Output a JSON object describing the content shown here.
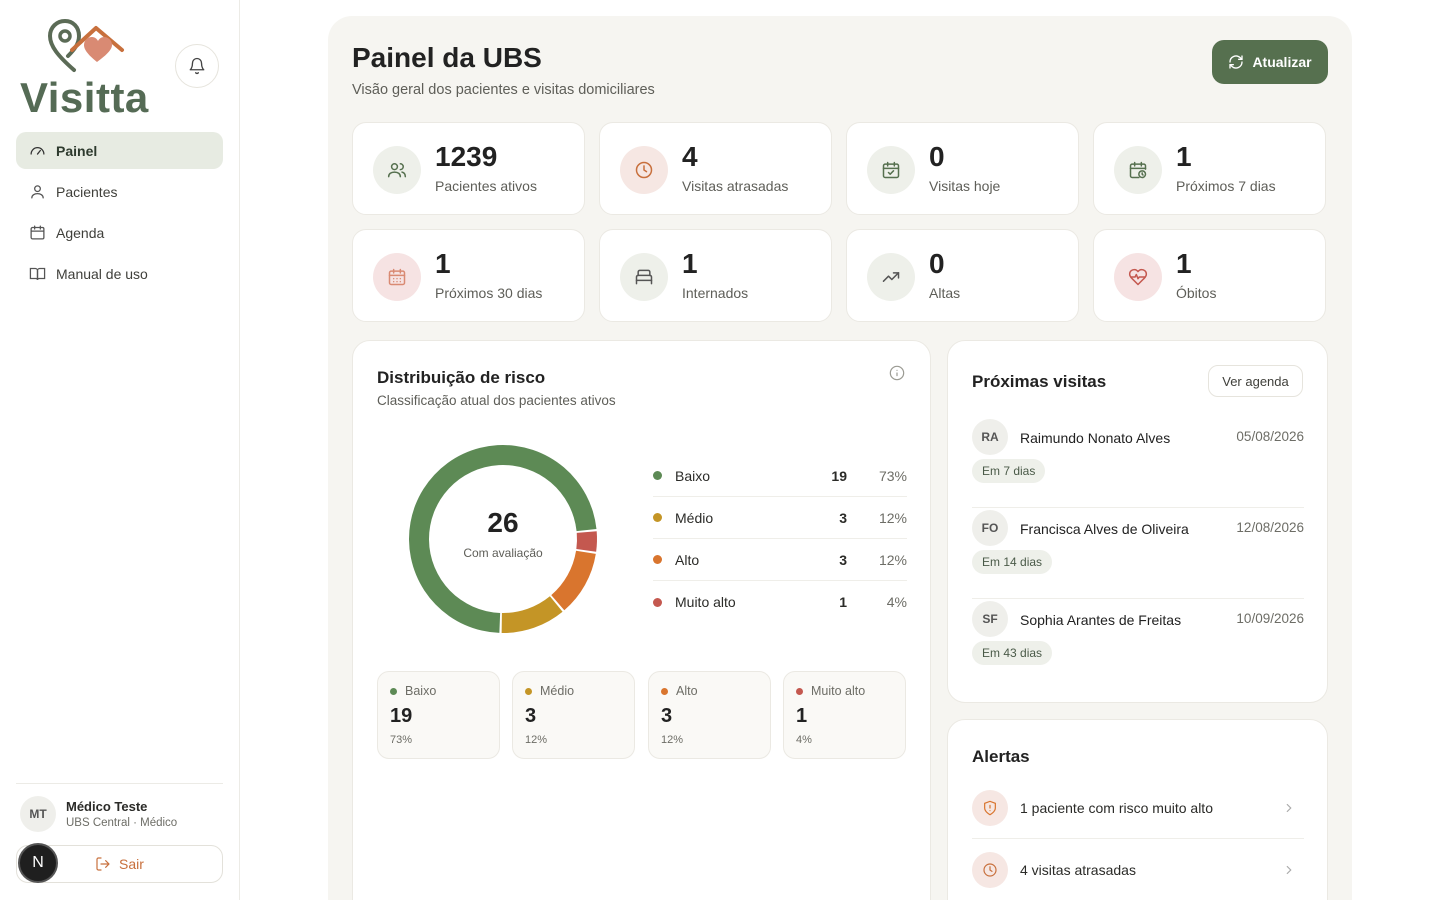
{
  "app": {
    "name": "Visitta"
  },
  "sidebar": {
    "items": [
      {
        "label": "Painel",
        "icon": "gauge-icon",
        "active": true
      },
      {
        "label": "Pacientes",
        "icon": "user-icon",
        "active": false
      },
      {
        "label": "Agenda",
        "icon": "calendar-icon",
        "active": false
      },
      {
        "label": "Manual de uso",
        "icon": "book-icon",
        "active": false
      }
    ],
    "user": {
      "initials": "MT",
      "name": "Médico Teste",
      "role": "UBS Central · Médico"
    },
    "logout_label": "Sair",
    "badge": "N"
  },
  "header": {
    "title": "Painel da UBS",
    "subtitle": "Visão geral dos pacientes e visitas domiciliares",
    "refresh_label": "Atualizar"
  },
  "stats": [
    {
      "value": "1239",
      "label": "Pacientes ativos",
      "icon": "users-icon"
    },
    {
      "value": "4",
      "label": "Visitas atrasadas",
      "icon": "clock-icon"
    },
    {
      "value": "0",
      "label": "Visitas hoje",
      "icon": "calendar-check-icon"
    },
    {
      "value": "1",
      "label": "Próximos 7 dias",
      "icon": "calendar-clock-icon"
    },
    {
      "value": "1",
      "label": "Próximos 30 dias",
      "icon": "calendar-grid-icon"
    },
    {
      "value": "1",
      "label": "Internados",
      "icon": "bed-icon"
    },
    {
      "value": "0",
      "label": "Altas",
      "icon": "trending-up-icon"
    },
    {
      "value": "1",
      "label": "Óbitos",
      "icon": "heart-pulse-icon"
    }
  ],
  "risk": {
    "title": "Distribuição de risco",
    "subtitle": "Classificação atual dos pacientes ativos",
    "total": "26",
    "total_label": "Com avaliação",
    "levels": [
      {
        "name": "Baixo",
        "count": "19",
        "pct": "73%",
        "color": "#5d8a55"
      },
      {
        "name": "Médio",
        "count": "3",
        "pct": "12%",
        "color": "#c49526"
      },
      {
        "name": "Alto",
        "count": "3",
        "pct": "12%",
        "color": "#d9752e"
      },
      {
        "name": "Muito alto",
        "count": "1",
        "pct": "4%",
        "color": "#c4584f"
      }
    ]
  },
  "chart_data": {
    "type": "pie",
    "categories": [
      "Baixo",
      "Médio",
      "Alto",
      "Muito alto"
    ],
    "values": [
      19,
      3,
      3,
      1
    ],
    "title": "Distribuição de risco"
  },
  "visits": {
    "title": "Próximas visitas",
    "link_label": "Ver agenda",
    "items": [
      {
        "initials": "RA",
        "name": "Raimundo Nonato Alves",
        "date": "05/08/2026",
        "tag": "Em 7 dias"
      },
      {
        "initials": "FO",
        "name": "Francisca Alves de Oliveira",
        "date": "12/08/2026",
        "tag": "Em 14 dias"
      },
      {
        "initials": "SF",
        "name": "Sophia Arantes de Freitas",
        "date": "10/09/2026",
        "tag": "Em 43 dias"
      }
    ]
  },
  "alerts": {
    "title": "Alertas",
    "items": [
      {
        "text": "1 paciente com risco muito alto",
        "icon": "shield-alert-icon"
      },
      {
        "text": "4 visitas atrasadas",
        "icon": "clock-icon"
      }
    ]
  }
}
